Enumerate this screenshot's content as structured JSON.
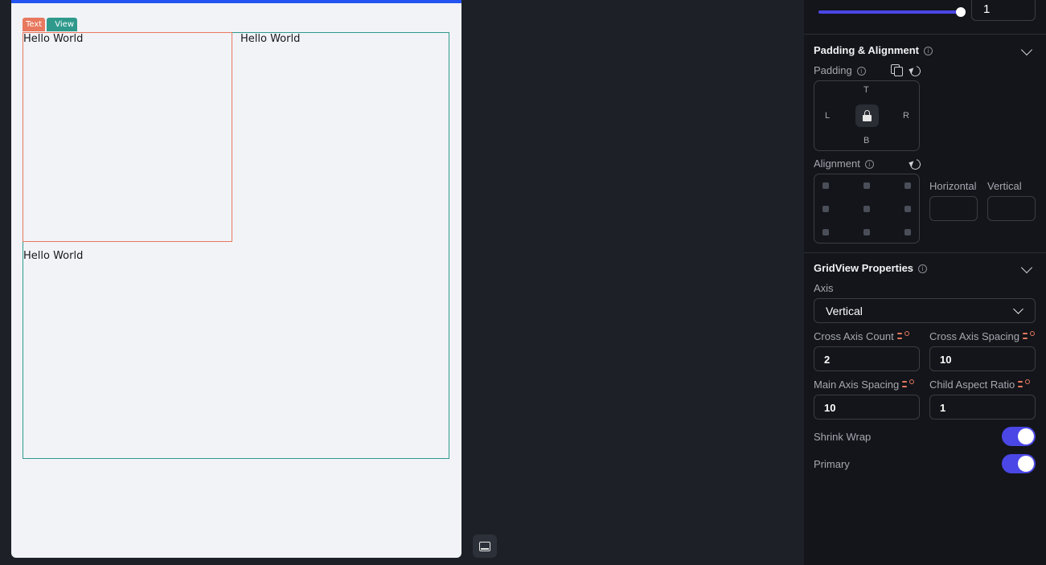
{
  "canvas": {
    "gridview_tag": "View",
    "text_tag": "Text",
    "cells": [
      "Hello World",
      "Hello World",
      "Hello World"
    ]
  },
  "slider": {
    "value": "1",
    "fraction": 0.97
  },
  "padding_alignment": {
    "title": "Padding & Alignment",
    "padding_label": "Padding",
    "sides": {
      "top": "T",
      "left": "L",
      "right": "R",
      "bottom": "B"
    },
    "alignment_label": "Alignment",
    "horizontal_label": "Horizontal",
    "vertical_label": "Vertical",
    "horizontal_value": "",
    "vertical_value": ""
  },
  "gridview": {
    "title": "GridView Properties",
    "axis_label": "Axis",
    "axis_value": "Vertical",
    "cross_axis_count_label": "Cross Axis Count",
    "cross_axis_count_value": "2",
    "cross_axis_spacing_label": "Cross Axis Spacing",
    "cross_axis_spacing_value": "10",
    "main_axis_spacing_label": "Main Axis Spacing",
    "main_axis_spacing_value": "10",
    "child_aspect_ratio_label": "Child Aspect Ratio",
    "child_aspect_ratio_value": "1",
    "shrink_wrap_label": "Shrink Wrap",
    "shrink_wrap_on": true,
    "primary_label": "Primary",
    "primary_on": true
  },
  "colors": {
    "accent": "#4b47e6",
    "gridview_outline": "#2f9a8c",
    "text_outline": "#e8785e",
    "canvas_bar": "#2354f2"
  },
  "icons": [
    "info-icon",
    "chevron-down-icon",
    "copy-icon",
    "reset-icon",
    "lock-icon",
    "variable-icon",
    "panel-toggle-icon"
  ]
}
